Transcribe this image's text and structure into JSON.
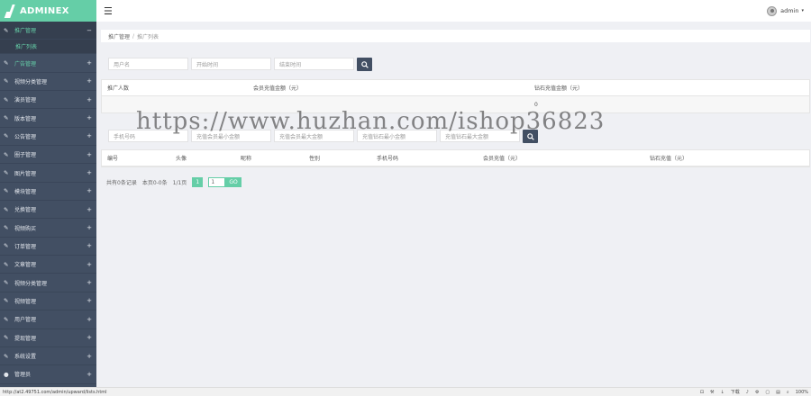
{
  "brand": {
    "logo_text": "ADMINEX"
  },
  "sidebar": {
    "items": [
      {
        "label": "推广管理",
        "icon": "edit-icon",
        "toggle": "−",
        "active": true
      },
      {
        "label": "推广列表",
        "submenu": true
      },
      {
        "label": "广告管理",
        "icon": "edit-icon",
        "toggle": "+"
      },
      {
        "label": "视频分类管理",
        "icon": "edit-icon",
        "toggle": "+"
      },
      {
        "label": "演员管理",
        "icon": "edit-icon",
        "toggle": "+"
      },
      {
        "label": "版本管理",
        "icon": "edit-icon",
        "toggle": "+"
      },
      {
        "label": "公告管理",
        "icon": "edit-icon",
        "toggle": "+"
      },
      {
        "label": "圈子管理",
        "icon": "edit-icon",
        "toggle": "+"
      },
      {
        "label": "图片管理",
        "icon": "edit-icon",
        "toggle": "+"
      },
      {
        "label": "模块管理",
        "icon": "edit-icon",
        "toggle": "+"
      },
      {
        "label": "兑换管理",
        "icon": "edit-icon",
        "toggle": "+"
      },
      {
        "label": "视频购买",
        "icon": "edit-icon",
        "toggle": "+"
      },
      {
        "label": "订单管理",
        "icon": "edit-icon",
        "toggle": "+"
      },
      {
        "label": "文章管理",
        "icon": "edit-icon",
        "toggle": "+"
      },
      {
        "label": "视频分类管理",
        "icon": "edit-icon",
        "toggle": "+"
      },
      {
        "label": "视频管理",
        "icon": "edit-icon",
        "toggle": "+"
      },
      {
        "label": "用户管理",
        "icon": "edit-icon",
        "toggle": "+"
      },
      {
        "label": "提现管理",
        "icon": "edit-icon",
        "toggle": "+"
      },
      {
        "label": "系统设置",
        "icon": "edit-icon",
        "toggle": "+"
      },
      {
        "label": "管理员",
        "icon": "user-icon",
        "toggle": "+"
      }
    ]
  },
  "header": {
    "menu_icon": "hamburger-icon",
    "user_name": "admin",
    "caret": "▾"
  },
  "breadcrumb": {
    "home": "推广管理",
    "sep": "/",
    "current": "推广列表"
  },
  "filter1": {
    "username_placeholder": "用户名",
    "start_placeholder": "开始时间",
    "end_placeholder": "结束时间",
    "search_icon": "search-icon"
  },
  "summary_table": {
    "headers": [
      "推广人数",
      "会员充值金额（元）",
      "钻石充值金额（元）"
    ],
    "row": [
      "",
      "",
      "0"
    ]
  },
  "filter2": {
    "phone_placeholder": "手机号码",
    "vip_min_placeholder": "充值会员最小金额",
    "vip_max_placeholder": "充值会员最大金额",
    "diamond_min_placeholder": "充值钻石最小金额",
    "diamond_max_placeholder": "充值钻石最大金额"
  },
  "user_table": {
    "headers": [
      "编号",
      "头像",
      "昵称",
      "性别",
      "手机号码",
      "会员充值（元）",
      "钻石充值（元）"
    ]
  },
  "pager": {
    "summary": "共有0条记录",
    "page_info": "本页0-0条",
    "pages": "1/1页",
    "current": "1",
    "input_value": "1",
    "go": "GO"
  },
  "watermark": "https://www.huzhan.com/ishop36823",
  "statusbar": {
    "url": "http://at2.49751.com/admin/upward/lists.html",
    "download": "下载",
    "zoom": "100%"
  },
  "colors": {
    "sidebar": "#424f63",
    "accent": "#65cea7",
    "background": "#eff0f4"
  }
}
